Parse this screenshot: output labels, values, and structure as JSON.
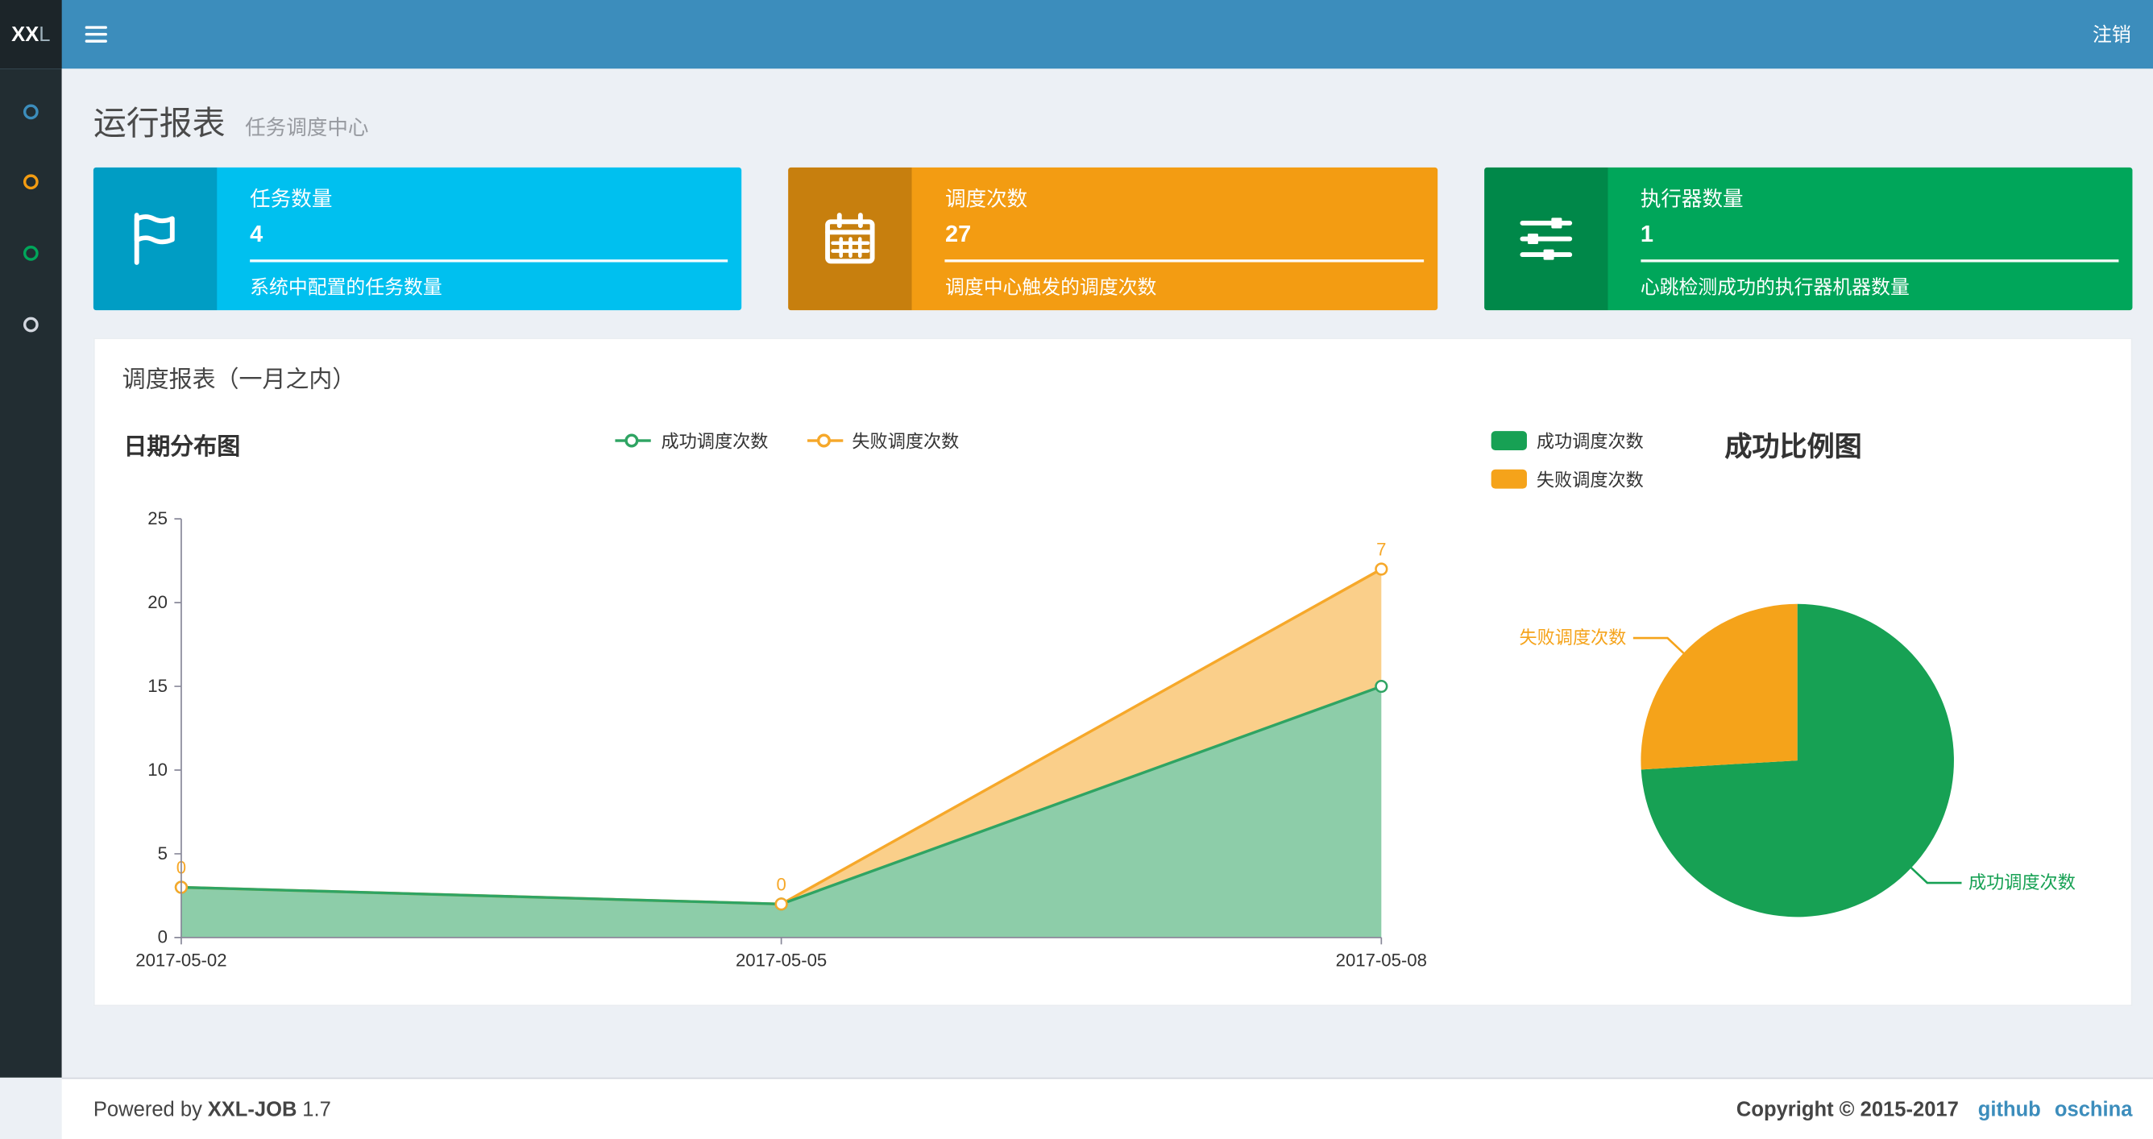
{
  "navbar": {
    "logo_bold": "XX",
    "logo_light": "L",
    "logout_label": "注销"
  },
  "sidebar": {
    "item_colors": [
      "#3c8dbc",
      "#f39c12",
      "#00a65a",
      "#d2d6de"
    ]
  },
  "page": {
    "title": "运行报表",
    "subtitle": "任务调度中心"
  },
  "info_boxes": [
    {
      "label": "任务数量",
      "value": "4",
      "desc": "系统中配置的任务数量",
      "color": "#00c0ef",
      "icon": "flag-icon"
    },
    {
      "label": "调度次数",
      "value": "27",
      "desc": "调度中心触发的调度次数",
      "color": "#f39c12",
      "icon": "calendar-icon"
    },
    {
      "label": "执行器数量",
      "value": "1",
      "desc": "心跳检测成功的执行器机器数量",
      "color": "#00a65a",
      "icon": "sliders-icon"
    }
  ],
  "panel": {
    "title": "调度报表（一月之内）"
  },
  "chart_data": [
    {
      "type": "area",
      "title": "日期分布图",
      "stacked": true,
      "x": [
        "2017-05-02",
        "2017-05-05",
        "2017-05-08"
      ],
      "series": [
        {
          "name": "成功调度次数",
          "values": [
            3,
            2,
            15
          ],
          "color": "#2FA463"
        },
        {
          "name": "失败调度次数",
          "values": [
            0,
            0,
            7
          ],
          "color": "#F6A82A",
          "point_labels": [
            "0",
            "0",
            "7"
          ]
        }
      ],
      "ylim": [
        0,
        25
      ],
      "yticks": [
        0,
        5,
        10,
        15,
        20,
        25
      ],
      "legend": [
        "成功调度次数",
        "失败调度次数"
      ],
      "legend_position": "top-center",
      "grid": false
    },
    {
      "type": "pie",
      "title": "成功比例图",
      "labels": [
        "成功调度次数",
        "失败调度次数"
      ],
      "values": [
        20,
        7
      ],
      "colors": [
        "#17A154",
        "#F5A31A"
      ],
      "legend_position": "top-left"
    }
  ],
  "footer": {
    "powered_by": "Powered by",
    "brand": "XXL-JOB",
    "version": "1.7",
    "copyright": "Copyright © 2015-2017",
    "links": [
      "github",
      "oschina"
    ]
  }
}
